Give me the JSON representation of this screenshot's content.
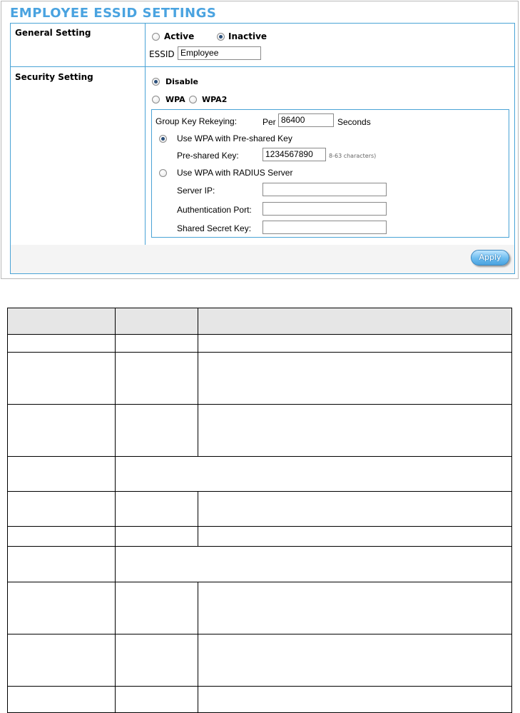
{
  "panel": {
    "title": "EMPLOYEE ESSID SETTINGS",
    "general": {
      "label": "General Setting",
      "active_label": "Active",
      "inactive_label": "Inactive",
      "status_selected": "Inactive",
      "essid_label": "ESSID",
      "essid_value": "Employee"
    },
    "security": {
      "label": "Security Setting",
      "disable_label": "Disable",
      "wpa_label": "WPA",
      "wpa2_label": "WPA2",
      "mode_selected": "Disable",
      "group_key_label": "Group Key Rekeying:",
      "per_label": "Per",
      "group_key_value": "86400",
      "seconds_label": "Seconds",
      "psk_option_label": "Use WPA with Pre-shared Key",
      "psk_label": "Pre-shared Key:",
      "psk_value": "1234567890",
      "psk_hint": "8-63 characters)",
      "radius_option_label": "Use WPA with RADIUS Server",
      "auth_selected": "Use WPA with Pre-shared Key",
      "server_ip_label": "Server IP:",
      "server_ip_value": "",
      "auth_port_label": "Authentication Port:",
      "auth_port_value": "",
      "shared_secret_label": "Shared Secret Key:",
      "shared_secret_value": ""
    },
    "apply_label": "Apply"
  },
  "colors": {
    "title": "#4aa3e0",
    "border": "#4aa3d6",
    "table_header": "#e6e6e6"
  }
}
